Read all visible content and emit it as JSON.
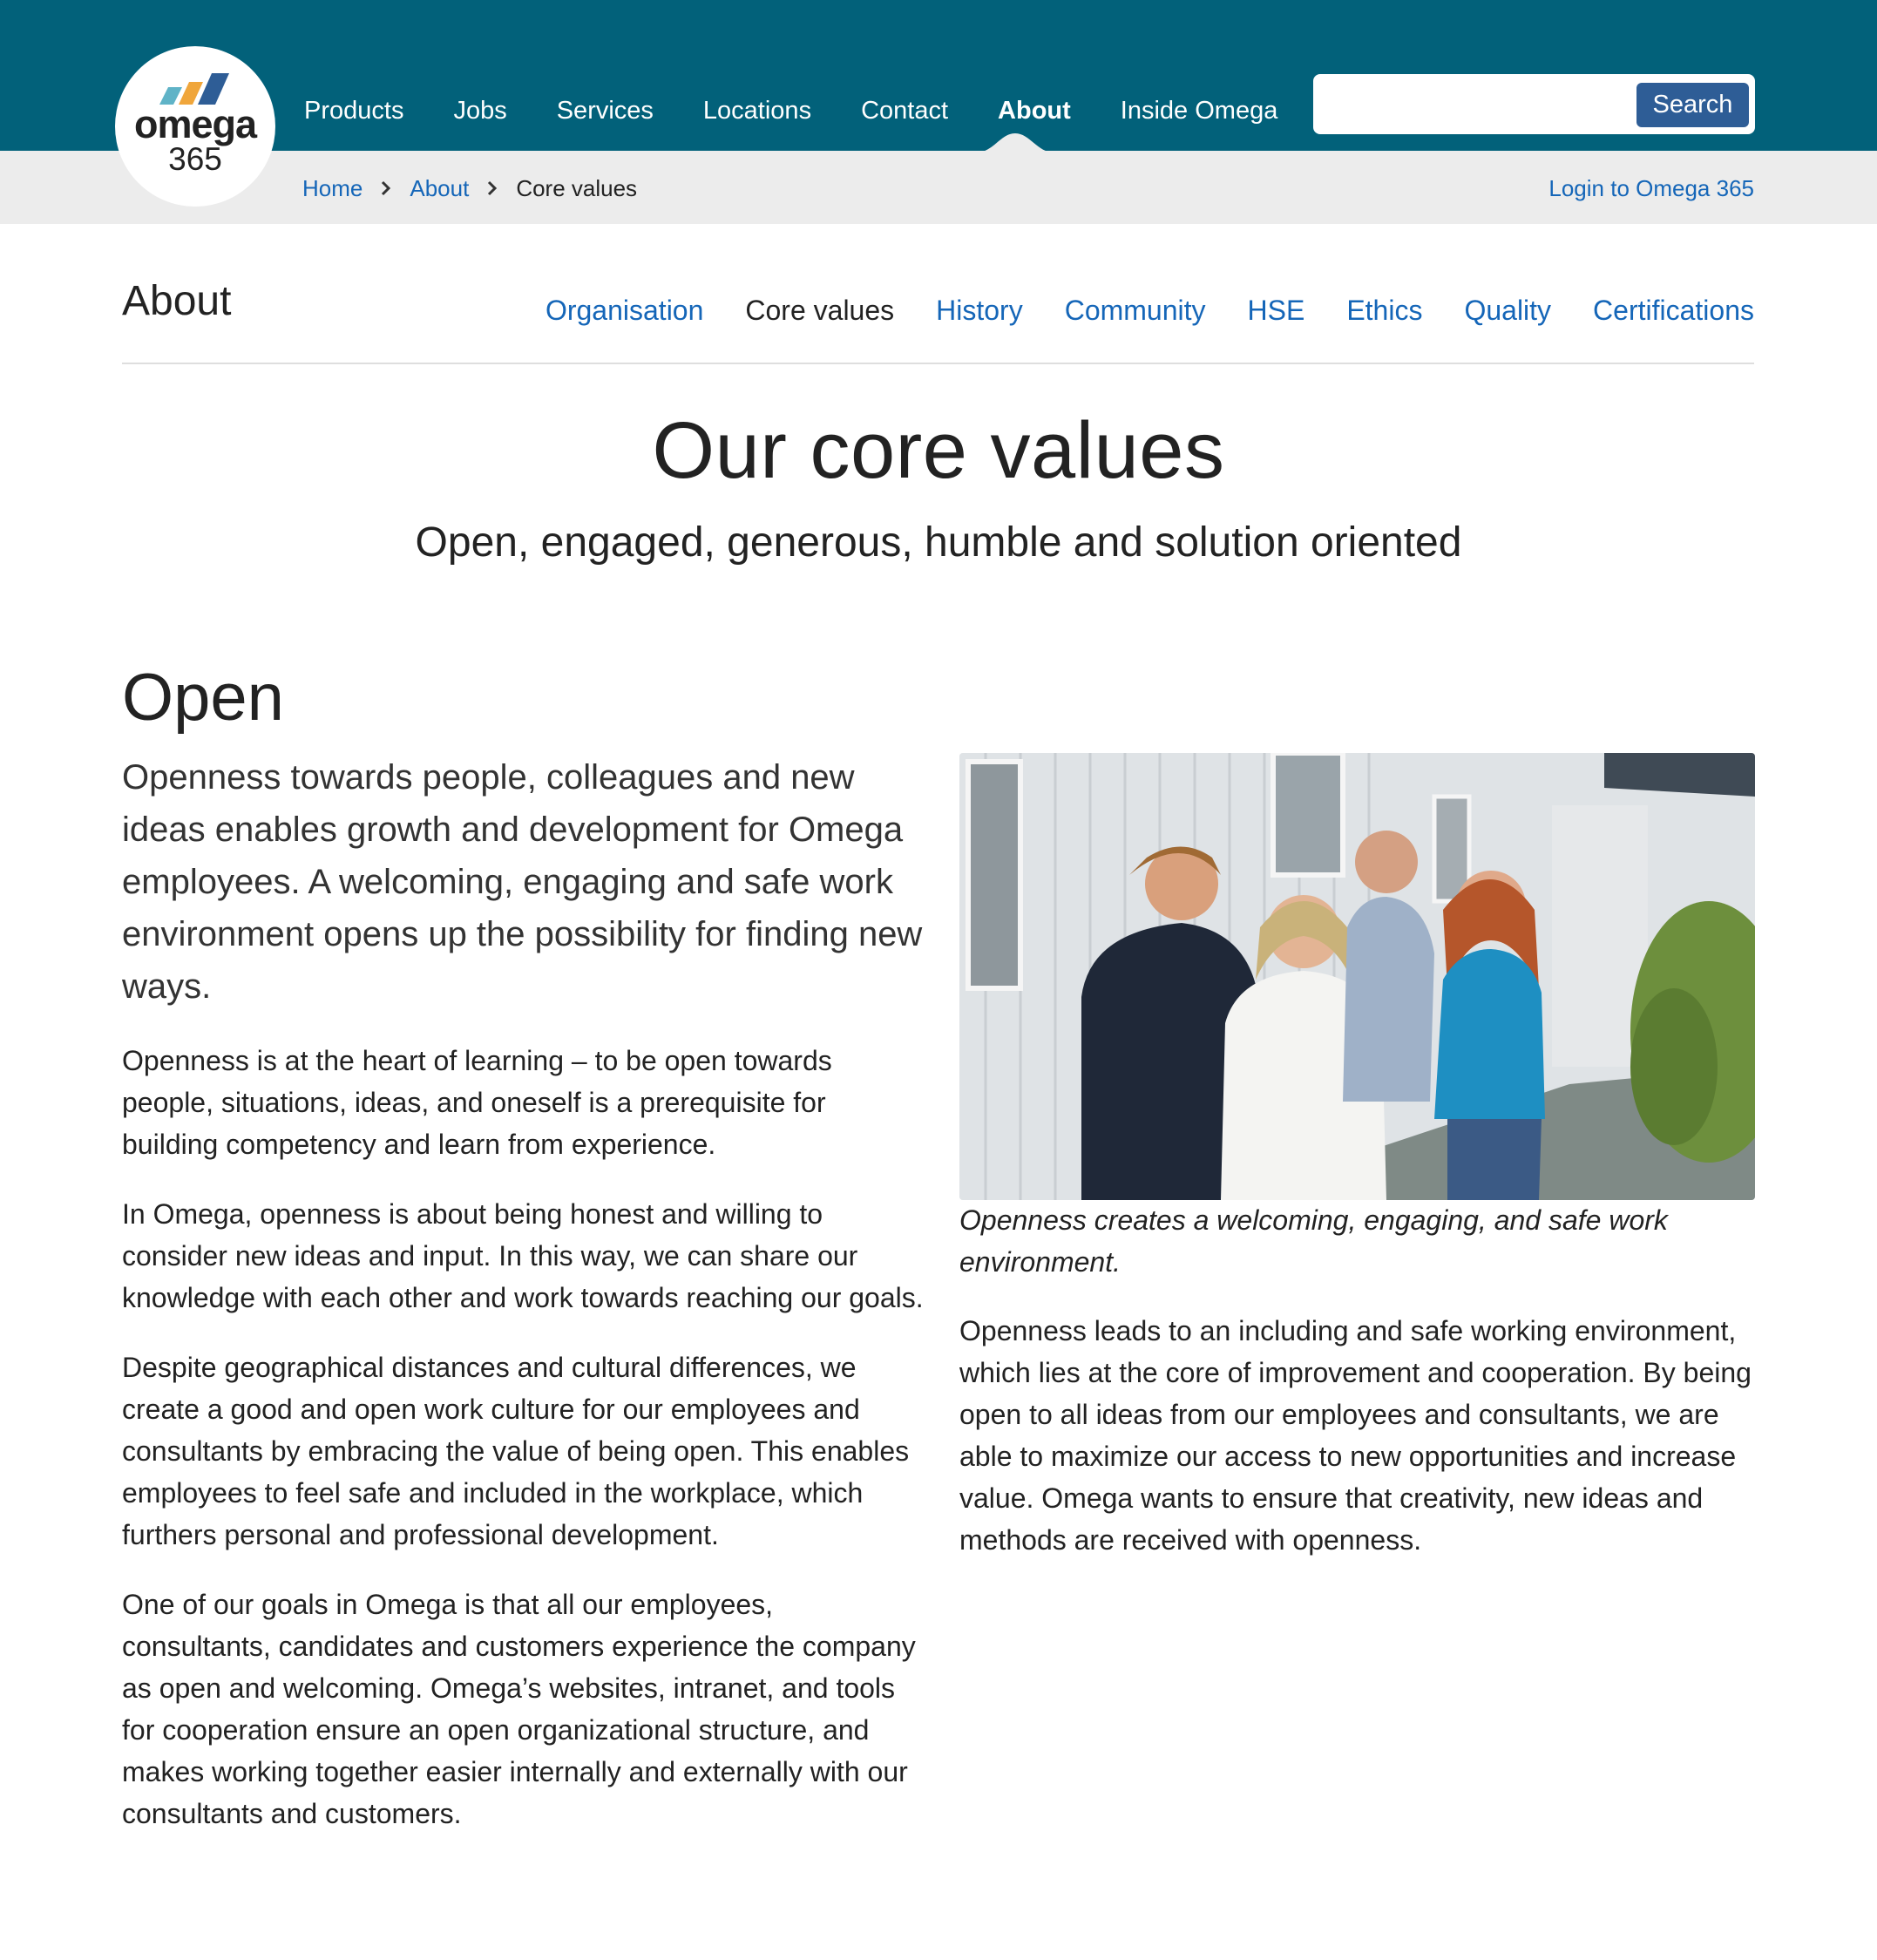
{
  "brand": {
    "logo_name": "omega",
    "logo_number": "365",
    "colors": {
      "header": "#02617a",
      "link": "#1566b8",
      "search_button": "#2e5d96",
      "subbar": "#ececec"
    }
  },
  "mainnav": {
    "items": [
      {
        "label": "Products"
      },
      {
        "label": "Jobs"
      },
      {
        "label": "Services"
      },
      {
        "label": "Locations"
      },
      {
        "label": "Contact"
      },
      {
        "label": "About",
        "active": true
      },
      {
        "label": "Inside Omega"
      }
    ]
  },
  "search": {
    "placeholder": "",
    "value": "",
    "button_label": "Search"
  },
  "breadcrumb": {
    "home": "Home",
    "about": "About",
    "current": "Core values"
  },
  "login": {
    "label": "Login to Omega 365"
  },
  "section": {
    "title": "About",
    "tabs": [
      {
        "label": "Organisation"
      },
      {
        "label": "Core values",
        "current": true
      },
      {
        "label": "History"
      },
      {
        "label": "Community"
      },
      {
        "label": "HSE"
      },
      {
        "label": "Ethics"
      },
      {
        "label": "Quality"
      },
      {
        "label": "Certifications"
      }
    ]
  },
  "hero": {
    "title": "Our core values",
    "subtitle": "Open, engaged, generous, humble and solution oriented"
  },
  "content": {
    "heading": "Open",
    "lead": "Openness towards people, colleagues and new ideas enables growth and development for Omega employees. A welcoming, engaging and safe work environment opens up the possibility for finding new ways.",
    "left_paragraphs": [
      "Openness is at the heart of learning – to be open towards people, situations, ideas, and oneself is a prerequisite for building competency and learn from experience.",
      "In Omega, openness is about being honest and willing to consider new ideas and input. In this way, we can share our knowledge with each other and work towards reaching our goals.",
      "Despite geographical distances and cultural differences, we create a good and open work culture for our employees and consultants by embracing the value of being open. This enables employees to feel safe and included in the workplace, which furthers personal and professional development.",
      "One of our goals in Omega is that all our employees, consultants, candidates and customers experience the company as open and welcoming. Omega’s websites, intranet, and tools for cooperation ensure an open organizational structure, and makes working together easier internally and externally with our consultants and customers."
    ],
    "photo_caption": "Openness creates a welcoming, engaging, and safe work environment.",
    "right_paragraph": "Openness leads to an including and safe working environment, which lies at the core of improvement and cooperation. By being open to all ideas from our employees and consultants, we are able to maximize our access to new opportunities and increase value. Omega wants to ensure that creativity, new ideas and methods are received with openness."
  },
  "icons": {
    "breadcrumb_separator": "chevron-right-icon",
    "logo": "omega-logo-mark"
  }
}
